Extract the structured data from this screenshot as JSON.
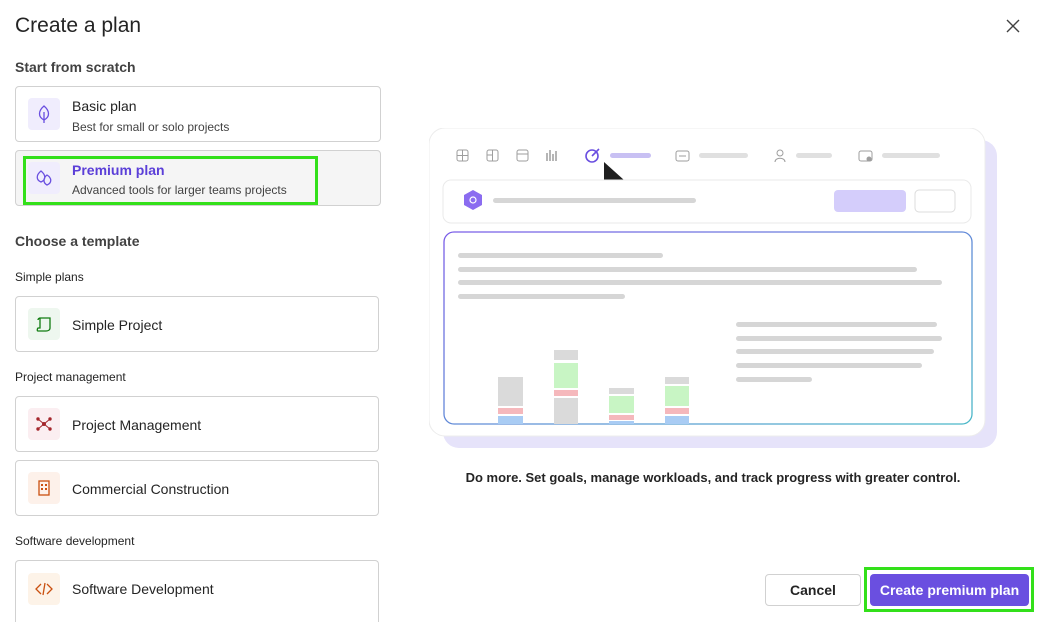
{
  "dialog": {
    "title": "Create a plan"
  },
  "scratch": {
    "heading": "Start from scratch",
    "basic": {
      "name": "Basic plan",
      "desc": "Best for small or solo projects"
    },
    "premium": {
      "name": "Premium plan",
      "desc": "Advanced tools for larger teams projects"
    }
  },
  "templates": {
    "heading": "Choose a template",
    "groups": [
      {
        "label": "Simple plans",
        "items": [
          "Simple Project"
        ]
      },
      {
        "label": "Project management",
        "items": [
          "Project Management",
          "Commercial Construction"
        ]
      },
      {
        "label": "Software development",
        "items": [
          "Software Development"
        ]
      }
    ]
  },
  "preview": {
    "tagline": "Do more. Set goals, manage workloads, and track progress with greater control."
  },
  "actions": {
    "cancel": "Cancel",
    "create": "Create premium plan"
  },
  "colors": {
    "accent": "#6a4fe0",
    "highlight": "#33e01a"
  }
}
